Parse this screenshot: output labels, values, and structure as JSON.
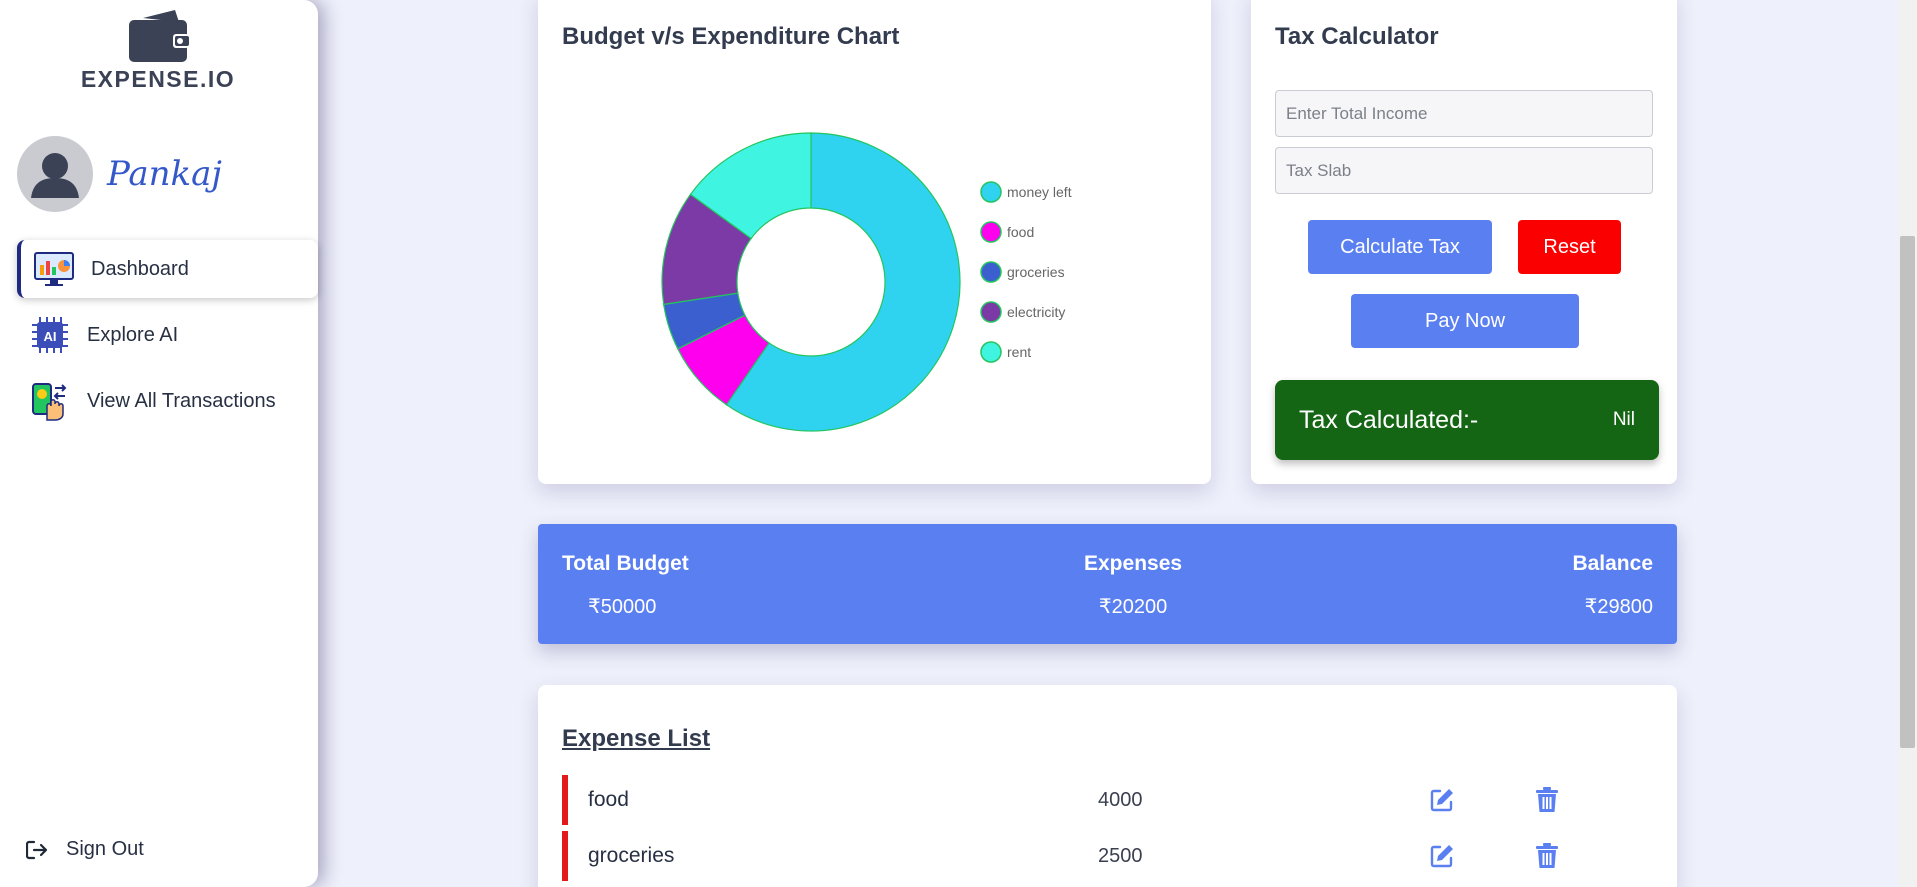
{
  "brand": {
    "name": "EXPENSE.IO",
    "icon": "wallet-icon"
  },
  "user": {
    "name": "Pankaj",
    "avatar_icon": "user-avatar-icon"
  },
  "sidebar": {
    "items": [
      {
        "label": "Dashboard",
        "icon": "dashboard-chart-icon",
        "active": true
      },
      {
        "label": "Explore AI",
        "icon": "ai-chip-icon",
        "active": false
      },
      {
        "label": "View All Transactions",
        "icon": "transactions-hand-icon",
        "active": false
      }
    ],
    "signout_label": "Sign Out",
    "signout_icon": "sign-out-icon"
  },
  "chart_card": {
    "title": "Budget v/s Expenditure Chart"
  },
  "chart_data": {
    "type": "pie",
    "variant": "doughnut",
    "categories": [
      "money left",
      "food",
      "groceries",
      "electricity",
      "rent"
    ],
    "values": [
      29800,
      4000,
      2500,
      6200,
      7500
    ],
    "colors": [
      "#2fd3ef",
      "#ff00ee",
      "#3b5fcf",
      "#7c3aa6",
      "#3ff4e0"
    ],
    "border_color": "#22c55e",
    "legend": "right"
  },
  "tax": {
    "title": "Tax Calculator",
    "income_placeholder": "Enter Total Income",
    "slab_placeholder": "Tax Slab",
    "calculate_label": "Calculate Tax",
    "reset_label": "Reset",
    "pay_label": "Pay Now",
    "result_label": "Tax Calculated:-",
    "result_value": "Nil"
  },
  "summary": {
    "budget_label": "Total Budget",
    "budget_value": "₹50000",
    "expenses_label": "Expenses",
    "expenses_value": "₹20200",
    "balance_label": "Balance",
    "balance_value": "₹29800"
  },
  "expense_list": {
    "title": "Expense List",
    "items": [
      {
        "name": "food",
        "amount": "4000"
      },
      {
        "name": "groceries",
        "amount": "2500"
      }
    ]
  },
  "colors": {
    "accent": "#5a7ff0",
    "danger": "#fb0000",
    "success": "#146614",
    "background": "#eef0fb"
  }
}
